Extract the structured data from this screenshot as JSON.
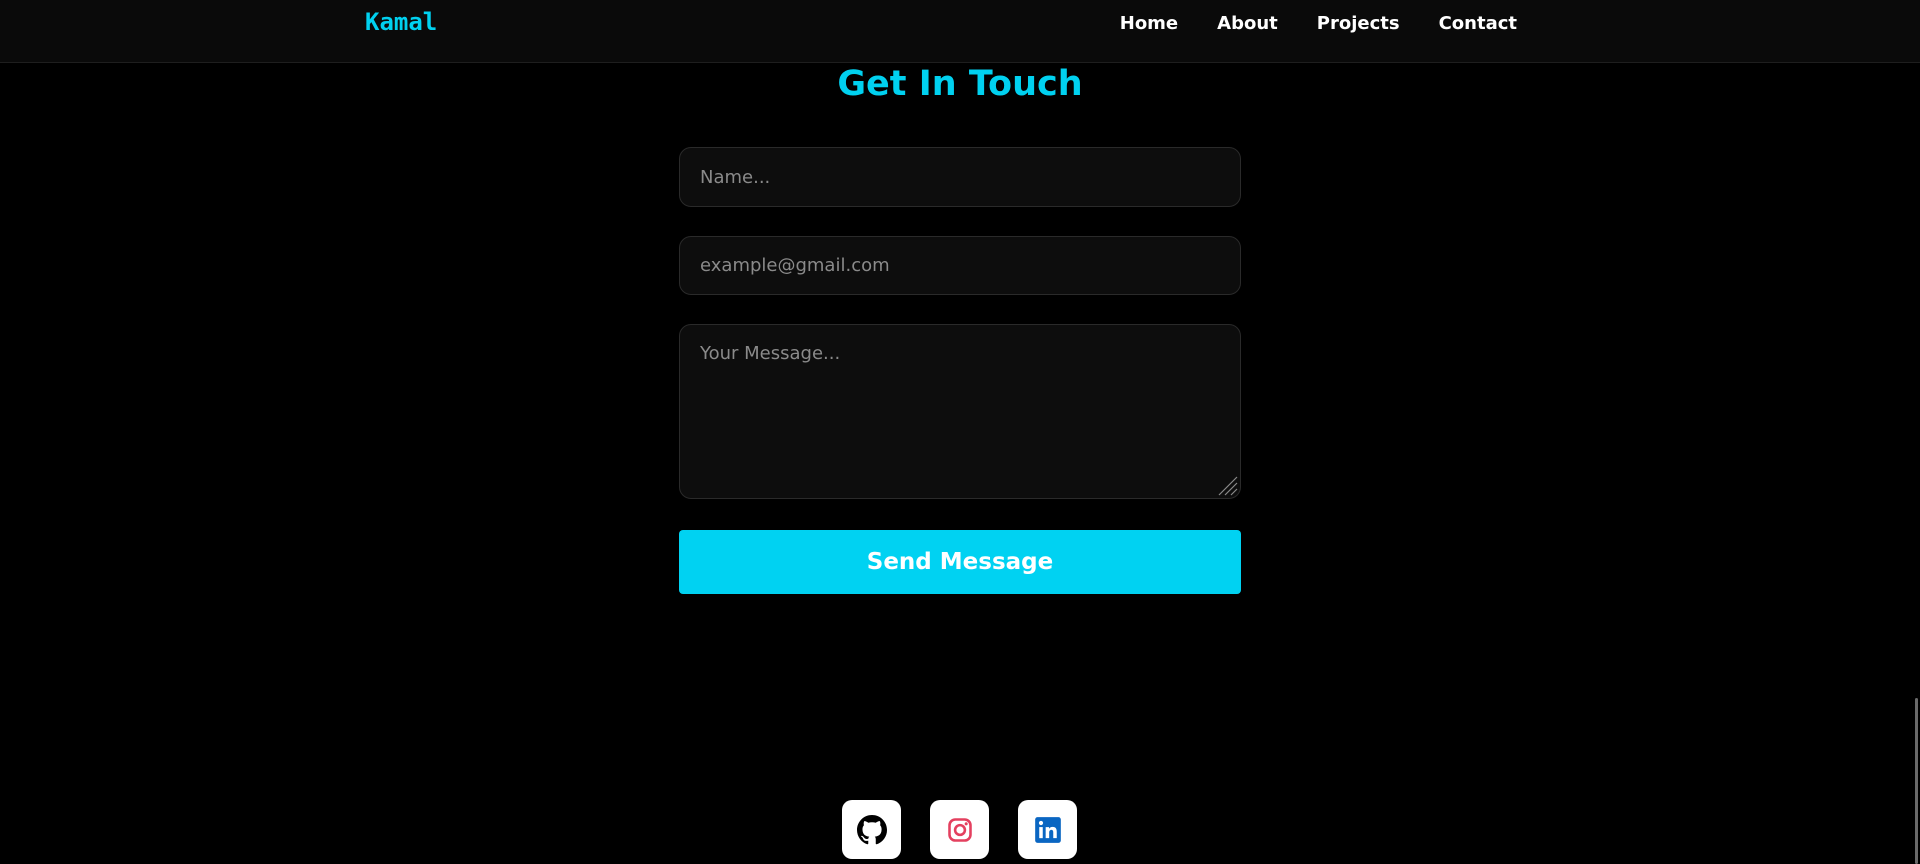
{
  "nav": {
    "brand": "Kamal",
    "links": [
      {
        "label": "Home"
      },
      {
        "label": "About"
      },
      {
        "label": "Projects"
      },
      {
        "label": "Contact"
      }
    ]
  },
  "contact": {
    "heading": "Get In Touch",
    "name_placeholder": "Name...",
    "name_value": "",
    "email_placeholder": "example@gmail.com",
    "email_value": "",
    "message_placeholder": "Your Message...",
    "message_value": "",
    "send_label": "Send Message"
  },
  "social": [
    {
      "icon": "github-icon",
      "color": "#000000"
    },
    {
      "icon": "instagram-icon",
      "color": "#e4405f"
    },
    {
      "icon": "linkedin-icon",
      "color": "#0a66c2"
    }
  ],
  "colors": {
    "accent": "#00d1f0",
    "background": "#000000",
    "field_background": "#0d0d0d"
  }
}
